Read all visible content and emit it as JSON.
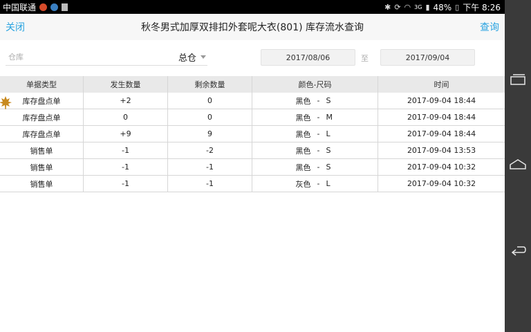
{
  "status_bar": {
    "carrier": "中国联通",
    "network": "3G",
    "battery": "48%",
    "time": "下午 8:26"
  },
  "title_bar": {
    "close_label": "关闭",
    "title": "秋冬男式加厚双排扣外套呢大衣(801) 库存流水查询",
    "query_label": "查询"
  },
  "filter": {
    "warehouse_label": "仓库",
    "warehouse_value": "总仓",
    "date_start": "2017/08/06",
    "date_sep": "至",
    "date_end": "2017/09/04"
  },
  "table": {
    "headers": [
      "单据类型",
      "发生数量",
      "剩余数量",
      "颜色-尺码",
      "时间"
    ],
    "rows": [
      {
        "type": "库存盘点单",
        "qty": "+2",
        "remain": "0",
        "color": "黑色",
        "sep": "-",
        "size": "S",
        "time": "2017-09-04 18:44"
      },
      {
        "type": "库存盘点单",
        "qty": "0",
        "remain": "0",
        "color": "黑色",
        "sep": "-",
        "size": "M",
        "time": "2017-09-04 18:44"
      },
      {
        "type": "库存盘点单",
        "qty": "+9",
        "remain": "9",
        "color": "黑色",
        "sep": "-",
        "size": "L",
        "time": "2017-09-04 18:44"
      },
      {
        "type": "销售单",
        "qty": "-1",
        "remain": "-2",
        "color": "黑色",
        "sep": "-",
        "size": "S",
        "time": "2017-09-04 13:53"
      },
      {
        "type": "销售单",
        "qty": "-1",
        "remain": "-1",
        "color": "黑色",
        "sep": "-",
        "size": "S",
        "time": "2017-09-04 10:32"
      },
      {
        "type": "销售单",
        "qty": "-1",
        "remain": "-1",
        "color": "灰色",
        "sep": "-",
        "size": "L",
        "time": "2017-09-04 10:32"
      }
    ]
  },
  "colors": {
    "accent": "#29a3e0",
    "header_bg": "#e9e9e9",
    "statusbar_bg": "#000000",
    "navbar_bg": "#3a3a3a"
  },
  "icons": {
    "statusbar": [
      "notification-icon",
      "globe-icon",
      "image-icon",
      "bluetooth-icon",
      "sync-icon",
      "wifi-icon",
      "signal-icon",
      "battery-icon"
    ],
    "navbar": [
      "recent-apps-icon",
      "home-icon",
      "back-icon"
    ],
    "row_decoration": "maple-leaf-icon"
  }
}
